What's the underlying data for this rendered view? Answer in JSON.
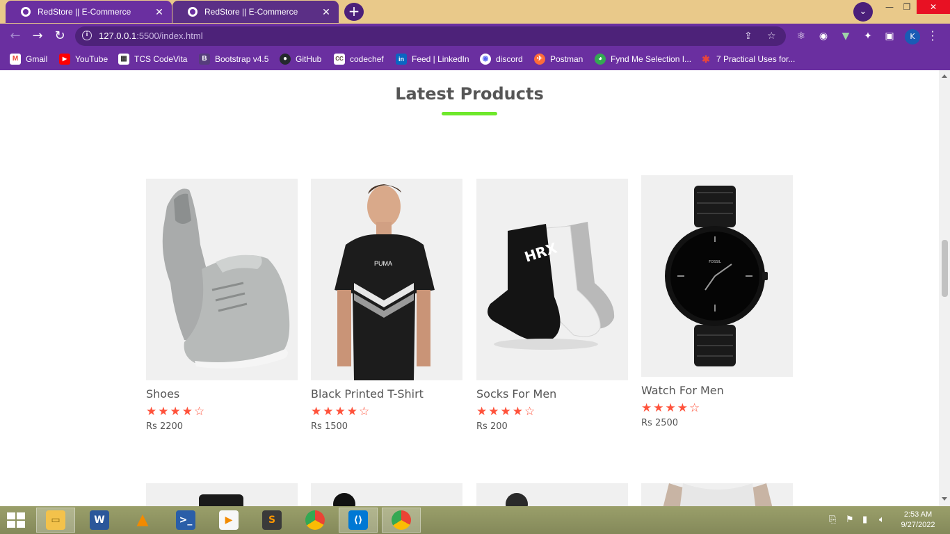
{
  "browser": {
    "tabs": [
      {
        "title": "RedStore || E-Commerce",
        "active": true
      },
      {
        "title": "RedStore || E-Commerce",
        "active": false
      }
    ],
    "url_host": "127.0.0.1",
    "url_rest": ":5500/index.html",
    "profile_initial": "K",
    "bookmarks": [
      {
        "label": "Gmail",
        "icon": "gmail-icon",
        "color": "#ea4335"
      },
      {
        "label": "YouTube",
        "icon": "youtube-icon",
        "color": "#ff0000"
      },
      {
        "label": "TCS CodeVita",
        "icon": "tcs-icon",
        "color": "#ffffff"
      },
      {
        "label": "Bootstrap v4.5",
        "icon": "bootstrap-icon",
        "color": "#563d7c"
      },
      {
        "label": "GitHub",
        "icon": "github-icon",
        "color": "#24292e"
      },
      {
        "label": "codechef",
        "icon": "codechef-icon",
        "color": "#5b4638"
      },
      {
        "label": "Feed | LinkedIn",
        "icon": "linkedin-icon",
        "color": "#0a66c2"
      },
      {
        "label": "discord",
        "icon": "discord-icon",
        "color": "#5865f2"
      },
      {
        "label": "Postman",
        "icon": "postman-icon",
        "color": "#ff6c37"
      },
      {
        "label": "Fynd Me Selection I...",
        "icon": "fynd-icon",
        "color": "#34a853"
      },
      {
        "label": "7 Practical Uses for...",
        "icon": "asterisk-icon",
        "color": "#e8453c"
      }
    ]
  },
  "section": {
    "title": "Latest Products"
  },
  "products": [
    {
      "name": "Shoes",
      "rating": "★★★★☆",
      "price": "Rs 2200"
    },
    {
      "name": "Black Printed T-Shirt",
      "rating": "★★★★☆",
      "price": "Rs 1500"
    },
    {
      "name": "Socks For Men",
      "rating": "★★★★☆",
      "price": "Rs 200"
    },
    {
      "name": "Watch For Men",
      "rating": "★★★★☆",
      "price": "Rs 2500"
    }
  ],
  "taskbar": {
    "time": "2:53 AM",
    "date": "9/27/2022"
  }
}
